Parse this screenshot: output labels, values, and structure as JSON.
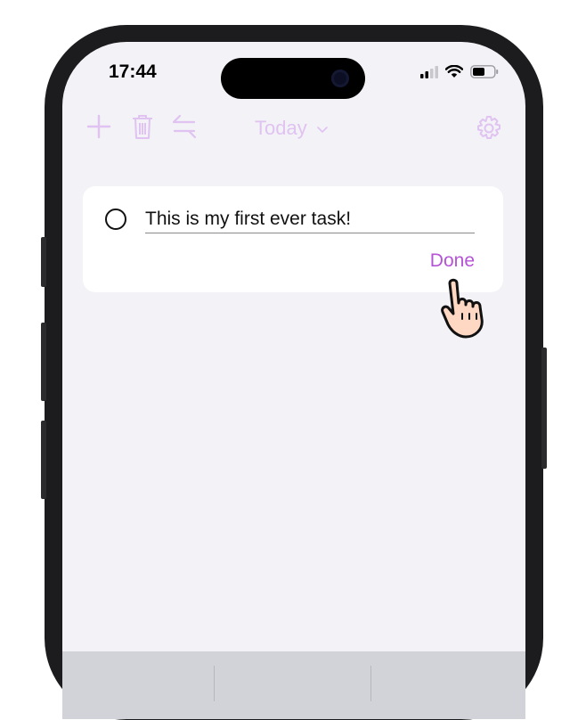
{
  "status_bar": {
    "time": "17:44"
  },
  "toolbar": {
    "title": "Today",
    "icons": [
      "plus-icon",
      "trash-icon",
      "swap-arrows-icon",
      "chevron-down-icon",
      "gear-icon"
    ],
    "accent_color": "#e0c3f0"
  },
  "task": {
    "text": "This is my first ever task!",
    "completed": false,
    "done_label": "Done",
    "done_color": "#b553d6"
  }
}
